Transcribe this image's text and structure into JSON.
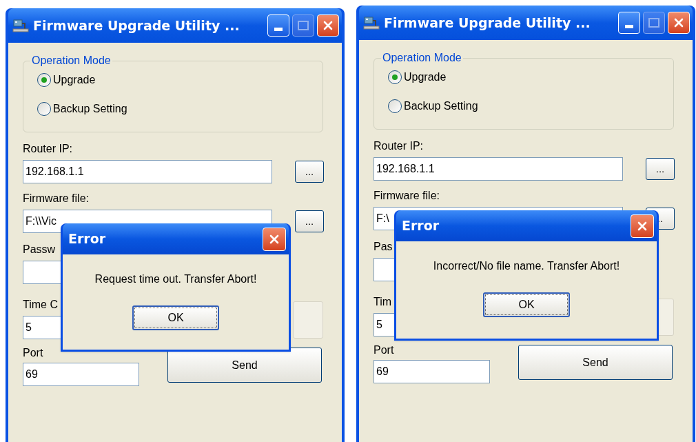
{
  "windows": [
    {
      "title": "Firmware Upgrade Utility ...",
      "maximize_enabled": false,
      "operation_mode": {
        "label": "Operation Mode",
        "options": [
          {
            "label": "Upgrade",
            "selected": true
          },
          {
            "label": "Backup Setting",
            "selected": false
          }
        ]
      },
      "router_ip": {
        "label": "Router IP:",
        "value": "192.168.1.1",
        "browse": "..."
      },
      "firmware_file": {
        "label": "Firmware file:",
        "value": "F:\\\\Vic",
        "browse": "..."
      },
      "password": {
        "label": "Passw"
      },
      "time_out": {
        "label": "Time C",
        "value": "5"
      },
      "port": {
        "label": "Port",
        "value": "69"
      },
      "send_button": "Send",
      "dialog": {
        "title": "Error",
        "message": "Request time out. Transfer Abort!",
        "button": "OK"
      }
    },
    {
      "title": "Firmware Upgrade Utility ...",
      "maximize_enabled": false,
      "operation_mode": {
        "label": "Operation Mode",
        "options": [
          {
            "label": "Upgrade",
            "selected": true
          },
          {
            "label": "Backup Setting",
            "selected": false
          }
        ]
      },
      "router_ip": {
        "label": "Router IP:",
        "value": "192.168.1.1",
        "browse": "..."
      },
      "firmware_file": {
        "label": "Firmware file:",
        "value": "F:\\",
        "browse": ".."
      },
      "password": {
        "label": "Pas"
      },
      "time_out": {
        "label": "Tim",
        "value": "5"
      },
      "port": {
        "label": "Port",
        "value": "69"
      },
      "send_button": "Send",
      "dialog": {
        "title": "Error",
        "message": "Incorrect/No file name. Transfer Abort!",
        "button": "OK"
      }
    }
  ]
}
